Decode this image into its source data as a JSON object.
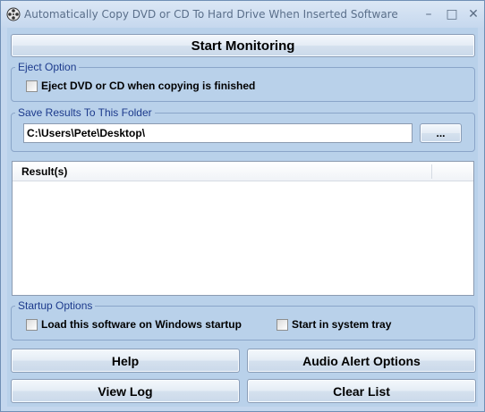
{
  "window": {
    "title": "Automatically Copy DVD or CD To Hard Drive When Inserted Software",
    "minimize_glyph": "–",
    "maximize_glyph": "□",
    "close_glyph": "✕"
  },
  "buttons": {
    "start_monitoring": "Start Monitoring",
    "browse": "...",
    "help": "Help",
    "audio_alert_options": "Audio Alert Options",
    "view_log": "View Log",
    "clear_list": "Clear List"
  },
  "eject_option": {
    "label": "Eject Option",
    "checkbox_label": "Eject DVD or CD when copying is finished",
    "checked": false
  },
  "save_folder": {
    "label": "Save Results To This Folder",
    "path": "C:\\Users\\Pete\\Desktop\\"
  },
  "results": {
    "columns": [
      "Result(s)"
    ],
    "rows": []
  },
  "startup_options": {
    "label": "Startup Options",
    "load_on_startup_label": "Load this software on Windows startup",
    "load_on_startup_checked": false,
    "start_in_tray_label": "Start in system tray",
    "start_in_tray_checked": false
  },
  "colors": {
    "background": "#b9d1ea",
    "group_label": "#1c3a8c",
    "group_border": "#8aa5c9"
  },
  "icons": {
    "app": "film-reel-icon"
  }
}
